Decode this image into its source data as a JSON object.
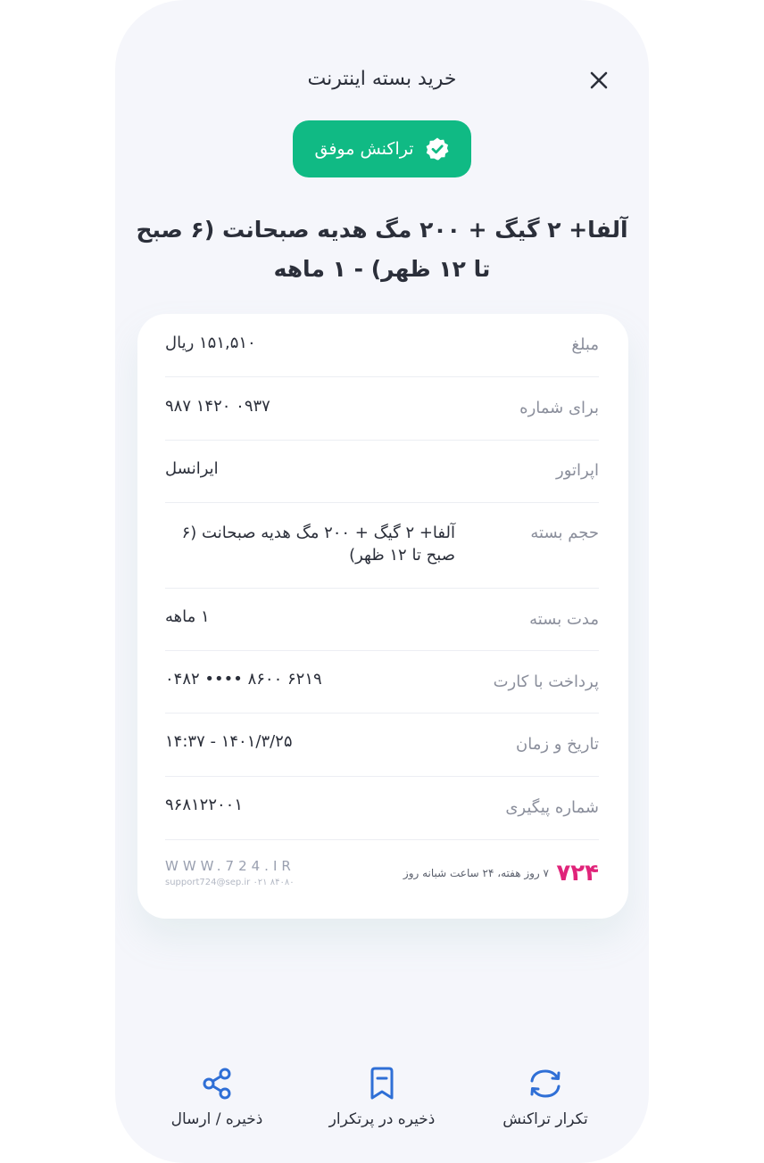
{
  "header": {
    "title": "خرید بسته اینترنت"
  },
  "status": {
    "label": "تراکنش موفق",
    "color": "#10ba84"
  },
  "package_title": "آلفا+ ۲ گیگ + ۲۰۰ مگ هدیه صبحانت (۶ صبح تا ۱۲ ظهر) - ۱ ماهه",
  "details": [
    {
      "label": "مبلغ",
      "value": "۱۵۱,۵۱۰ ریال"
    },
    {
      "label": "برای شماره",
      "value": "۰۹۳۷ ۱۴۲۰ ۹۸۷"
    },
    {
      "label": "اپراتور",
      "value": "ایرانسل"
    },
    {
      "label": "حجم بسته",
      "value": "آلفا+ ۲ گیگ + ۲۰۰ مگ هدیه صبحانت (۶ صبح تا ۱۲ ظهر)"
    },
    {
      "label": "مدت بسته",
      "value": "۱ ماهه"
    },
    {
      "label": "پرداخت با کارت",
      "value": "۶۲۱۹  ۸۶۰۰  ••••  ۰۴۸۲"
    },
    {
      "label": "تاریخ و زمان",
      "value": "۱۴۰۱/۳/۲۵ - ۱۴:۳۷"
    },
    {
      "label": "شماره پیگیری",
      "value": "۹۶۸۱۲۲۰۰۱"
    }
  ],
  "footer": {
    "brand": "۷۲۴",
    "support_text": "۷ روز هفته، ۲۴ ساعت شبانه روز",
    "website": "WWW.724.IR",
    "contact": "support724@sep.ir   ۰۲۱ ۸۴۰۸۰",
    "brand_color": "#e0247a"
  },
  "actions": [
    {
      "label": "تکرار تراکنش",
      "icon": "repeat-icon"
    },
    {
      "label": "ذخیره در پرتکرار",
      "icon": "bookmark-icon"
    },
    {
      "label": "ذخیره / ارسال",
      "icon": "share-icon"
    }
  ],
  "colors": {
    "accent_blue": "#2f6fd6",
    "background": "#f5f6fb"
  }
}
